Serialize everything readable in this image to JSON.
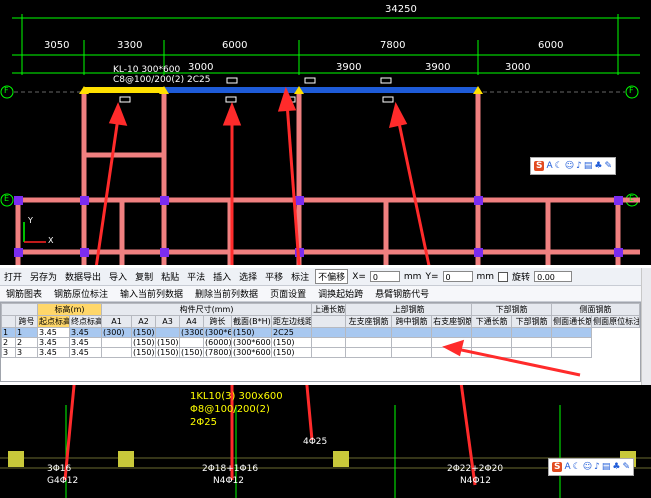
{
  "drawing_top": {
    "total_dim": "34250",
    "dims_row1": [
      "3050",
      "3300",
      "6000",
      "7800",
      "6000"
    ],
    "dims_row2": [
      "3000",
      "3900",
      "3900",
      "3000"
    ],
    "beam_label": "KL-10 300*600",
    "beam_label2": "C8@100/200(2) 2C25",
    "axis_f": "F",
    "axis_e": "E",
    "axis_y": "Y",
    "axis_x": "X",
    "colors": {
      "beam_pink": "#f08080",
      "beam_blue": "#1e5bd8",
      "beam_yellow": "#ffe000",
      "column_purple": "#7b2cf0"
    }
  },
  "toolbar": {
    "items": [
      "打开",
      "另存为",
      "数据导出",
      "导入",
      "复制",
      "粘贴",
      "平法",
      "插入",
      "选择",
      "平移",
      "标注",
      "不偏移"
    ],
    "x_label": "X=",
    "x_value": "0",
    "mm1": "mm",
    "y_label": "Y=",
    "y_value": "0",
    "mm2": "mm",
    "rotate_label": "旋转",
    "rotate_value": "0.00"
  },
  "toolbar2": {
    "items": [
      "钢筋图表",
      "钢筋原位标注",
      "输入当前列数据",
      "删除当前列数据",
      "页面设置",
      "调换起始跨",
      "悬臂钢筋代号"
    ]
  },
  "grid": {
    "group_headers": [
      "标高(m)",
      "构件尺寸(mm)",
      "上通长筋",
      "上部钢筋",
      "下部钢筋",
      "侧面钢筋"
    ],
    "col_headers": [
      "跨号",
      "起点标高",
      "终点标高",
      "A1",
      "A2",
      "A3",
      "A4",
      "跨长",
      "截面(B*H)",
      "距左边线距离",
      "",
      "左支座钢筋",
      "跨中钢筋",
      "右支座钢筋",
      "下通长筋",
      "下部钢筋",
      "侧面通长筋",
      "侧面原位标注筋"
    ],
    "rows": [
      [
        "1",
        "1",
        "3.45",
        "3.45",
        "(300)",
        "(150)",
        "",
        "(3300)",
        "(300*600)",
        "(150)",
        "2C25",
        "",
        "",
        "",
        "",
        "",
        "",
        ""
      ],
      [
        "2",
        "2",
        "3.45",
        "3.45",
        "",
        "(150)",
        "(150)",
        "",
        "(6000)",
        "(300*600)",
        "(150)",
        "",
        "",
        "",
        "",
        "",
        "",
        ""
      ],
      [
        "3",
        "3",
        "3.45",
        "3.45",
        "",
        "(150)",
        "(150)",
        "(150)",
        "(7800)",
        "(300*600)",
        "(150)",
        "",
        "",
        "",
        "",
        "",
        "",
        ""
      ]
    ]
  },
  "drawing_bottom": {
    "beam_title": "1KL10(3) 300x600",
    "beam_stirrup": "Φ8@100/200(2)",
    "beam_top": "2Φ25",
    "label_4phi25": "4Φ25",
    "bottom_labels": [
      "3Φ16",
      "2Φ18+1Φ16",
      "2Φ22+2Φ20"
    ],
    "side_labels": [
      "G4Φ12",
      "N4Φ12",
      "N4Φ12"
    ]
  },
  "toolbox": {
    "logo": "S",
    "letters": "A"
  }
}
